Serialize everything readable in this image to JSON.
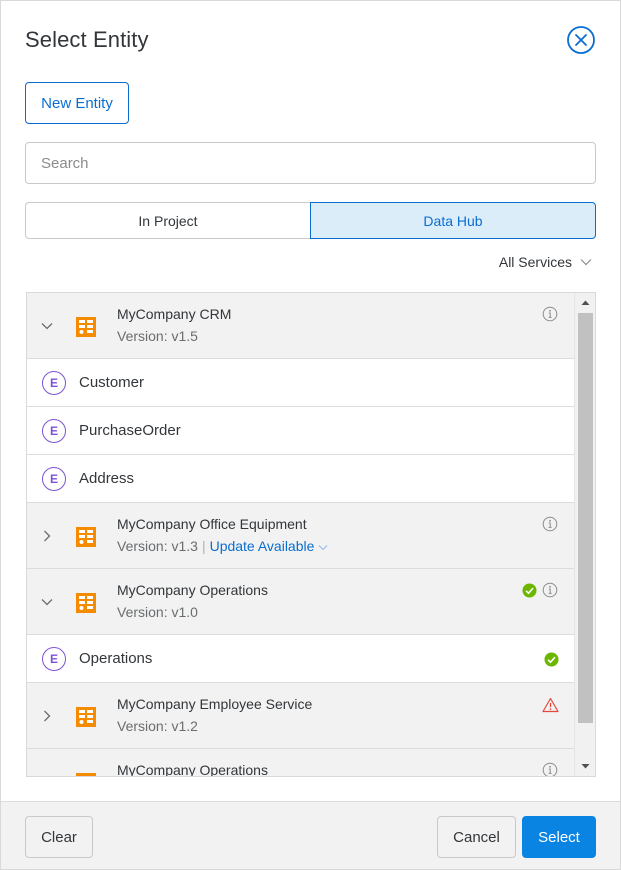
{
  "dialog": {
    "title": "Select Entity",
    "close_icon": "close-circle-icon"
  },
  "toolbar": {
    "new_entity_label": "New Entity"
  },
  "search": {
    "placeholder": "Search",
    "value": ""
  },
  "tabs": [
    {
      "label": "In Project",
      "selected": false
    },
    {
      "label": "Data Hub",
      "selected": true
    }
  ],
  "filter": {
    "label": "All Services",
    "icon": "chevron-down-icon"
  },
  "list": {
    "services": [
      {
        "name": "MyCompany CRM",
        "version": "Version: v1.5",
        "expanded": true,
        "status": "info",
        "entities": [
          {
            "badge": "E",
            "name": "Customer"
          },
          {
            "badge": "E",
            "name": "PurchaseOrder"
          },
          {
            "badge": "E",
            "name": "Address"
          }
        ]
      },
      {
        "name": "MyCompany Office Equipment",
        "version": "Version: v1.3",
        "separator": "|",
        "update_label": "Update Available",
        "expanded": false,
        "status": "info"
      },
      {
        "name": "MyCompany Operations",
        "version": "Version: v1.0",
        "expanded": true,
        "status": "ok+info",
        "entities": [
          {
            "badge": "E",
            "name": "Operations",
            "status": "ok"
          }
        ]
      },
      {
        "name": "MyCompany Employee Service",
        "version": "Version: v1.2",
        "expanded": false,
        "status": "warning"
      },
      {
        "name": "MyCompany Operations",
        "version": "",
        "expanded": false,
        "status": "info"
      }
    ]
  },
  "footer": {
    "clear_label": "Clear",
    "cancel_label": "Cancel",
    "select_label": "Select"
  },
  "colors": {
    "accent": "#0a6ed1",
    "primary_button": "#0a84e3",
    "selected_tab_bg": "#dcedfa",
    "entity_badge": "#7e52d6",
    "service_icon": "#f58b00",
    "success": "#6bb700",
    "warning": "#e34a3c"
  }
}
